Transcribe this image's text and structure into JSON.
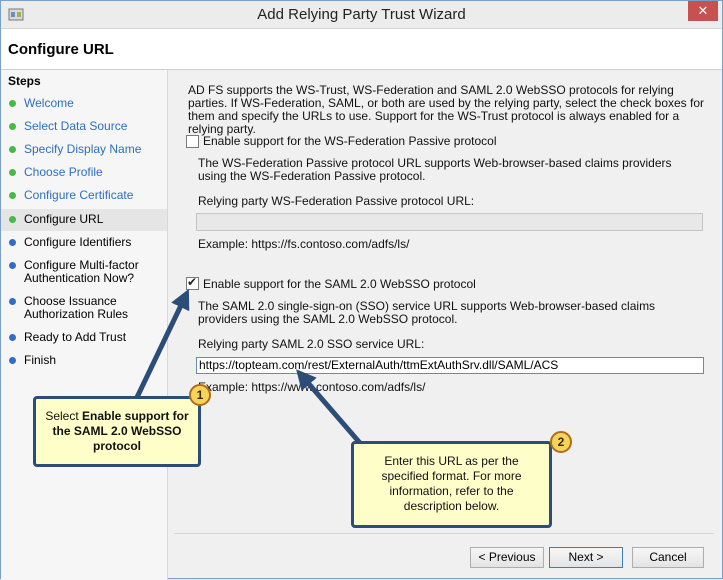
{
  "window": {
    "title": "Add Relying Party Trust Wizard",
    "close_glyph": "✕"
  },
  "header": {
    "title": "Configure URL"
  },
  "sidebar": {
    "heading": "Steps",
    "items": [
      {
        "label": "Welcome",
        "state": "done"
      },
      {
        "label": "Select Data Source",
        "state": "done"
      },
      {
        "label": "Specify Display Name",
        "state": "done"
      },
      {
        "label": "Choose Profile",
        "state": "done"
      },
      {
        "label": "Configure Certificate",
        "state": "done"
      },
      {
        "label": "Configure URL",
        "state": "current"
      },
      {
        "label": "Configure Identifiers",
        "state": "todo"
      },
      {
        "label": "Configure Multi-factor Authentication Now?",
        "state": "todo"
      },
      {
        "label": "Choose Issuance Authorization Rules",
        "state": "todo"
      },
      {
        "label": "Ready to Add Trust",
        "state": "todo"
      },
      {
        "label": "Finish",
        "state": "todo"
      }
    ]
  },
  "content": {
    "intro": "AD FS supports the WS-Trust, WS-Federation and SAML 2.0 WebSSO protocols for relying parties.  If WS-Federation, SAML, or both are used by the relying party, select the check boxes for them and specify the URLs to use.  Support for the WS-Trust protocol is always enabled for a relying party.",
    "wsfed": {
      "checkbox_label": "Enable support for the WS-Federation Passive protocol",
      "checked": false,
      "description": "The WS-Federation Passive protocol URL supports Web-browser-based claims providers using the WS-Federation Passive protocol.",
      "url_label": "Relying party WS-Federation Passive protocol URL:",
      "url_value": "",
      "example": "Example: https://fs.contoso.com/adfs/ls/"
    },
    "saml": {
      "checkbox_label": "Enable support for the SAML 2.0 WebSSO protocol",
      "checked": true,
      "description": "The SAML 2.0 single-sign-on (SSO) service URL supports Web-browser-based claims providers using the SAML 2.0 WebSSO protocol.",
      "url_label": "Relying party SAML 2.0 SSO service URL:",
      "url_value": "https://topteam.com/rest/ExternalAuth/ttmExtAuthSrv.dll/SAML/ACS",
      "example": "Example: https://www.contoso.com/adfs/ls/"
    }
  },
  "buttons": {
    "previous": "< Previous",
    "next": "Next >",
    "cancel": "Cancel"
  },
  "callouts": [
    {
      "number": "1",
      "text_pre": "Select ",
      "text_bold": "Enable support for the SAML 2.0 WebSSO protocol"
    },
    {
      "number": "2",
      "text": "Enter this URL as per the specified format. For more information, refer to the description below."
    }
  ],
  "colors": {
    "accent_blue": "#2c4d78",
    "callout_fill": "#fefec8",
    "badge_fill": "#f6d45a",
    "done_green": "#47b947"
  }
}
